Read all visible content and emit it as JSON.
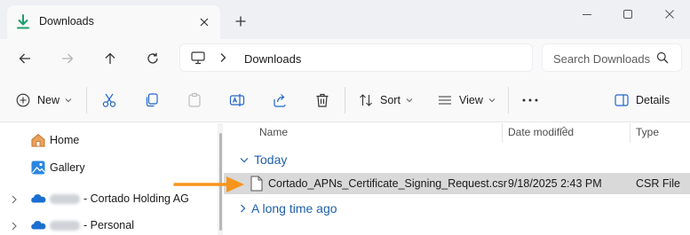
{
  "window": {
    "tab_title": "Downloads",
    "tab_icon": "download-arrow-icon",
    "new_tab_icon": "plus-icon",
    "controls": [
      "minimize-icon",
      "maximize-icon",
      "close-icon"
    ]
  },
  "nav": {
    "back_icon": "arrow-left-icon",
    "forward_icon": "arrow-right-icon",
    "up_icon": "arrow-up-icon",
    "refresh_icon": "refresh-icon",
    "address": {
      "location_icon": "computer-icon",
      "segment": "Downloads"
    },
    "search": {
      "placeholder": "Search Downloads"
    }
  },
  "toolbar": {
    "new_label": "New",
    "sort_label": "Sort",
    "view_label": "View",
    "more_label": "···",
    "details_label": "Details",
    "icons": [
      "cut-icon",
      "copy-icon",
      "paste-icon",
      "rename-icon",
      "share-icon",
      "delete-icon"
    ]
  },
  "sidebar": {
    "items": [
      {
        "label": "Home",
        "icon": "home-icon"
      },
      {
        "label": "Gallery",
        "icon": "gallery-icon"
      },
      {
        "label": "- Cortado Holding AG",
        "icon": "onedrive-icon"
      },
      {
        "label": "- Personal",
        "icon": "onedrive-icon"
      }
    ]
  },
  "columns": {
    "name": "Name",
    "date": "Date modified",
    "type": "Type"
  },
  "groups": {
    "today": "Today",
    "older": "A long time ago"
  },
  "files": [
    {
      "name": "Cortado_APNs_Certificate_Signing_Request.csr",
      "date": "9/18/2025 2:43 PM",
      "type": "CSR File"
    }
  ],
  "colors": {
    "accent": "#0067c0",
    "group_text": "#1f5fa8",
    "arrow": "#f7941d",
    "row_highlight": "#d9d9d9"
  }
}
